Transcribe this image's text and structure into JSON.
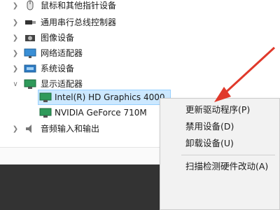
{
  "device_tree": {
    "items": [
      {
        "label": "鼠标和其他指针设备",
        "icon": "mouse-icon",
        "expanded": false
      },
      {
        "label": "通用串行总线控制器",
        "icon": "usb-icon",
        "expanded": false
      },
      {
        "label": "图像设备",
        "icon": "camera-icon",
        "expanded": false
      },
      {
        "label": "网络适配器",
        "icon": "network-icon",
        "expanded": false
      },
      {
        "label": "系统设备",
        "icon": "system-device-icon",
        "expanded": false
      },
      {
        "label": "显示适配器",
        "icon": "display-adapter-icon",
        "expanded": true
      },
      {
        "label": "Intel(R) HD Graphics 4000",
        "icon": "display-adapter-icon",
        "child": true,
        "selected": true
      },
      {
        "label": "NVIDIA GeForce 710M",
        "icon": "display-adapter-icon",
        "child": true
      },
      {
        "label": "音频输入和输出",
        "icon": "speaker-icon",
        "expanded": false
      }
    ]
  },
  "context_menu": {
    "items": [
      {
        "label": "更新驱动程序(P)"
      },
      {
        "label": "禁用设备(D)"
      },
      {
        "label": "卸载设备(U)"
      },
      {
        "label": "扫描检测硬件改动(A)"
      }
    ]
  },
  "colors": {
    "selection": "#cce8ff",
    "arrow": "#e0392b",
    "dark_bar": "#333333"
  }
}
